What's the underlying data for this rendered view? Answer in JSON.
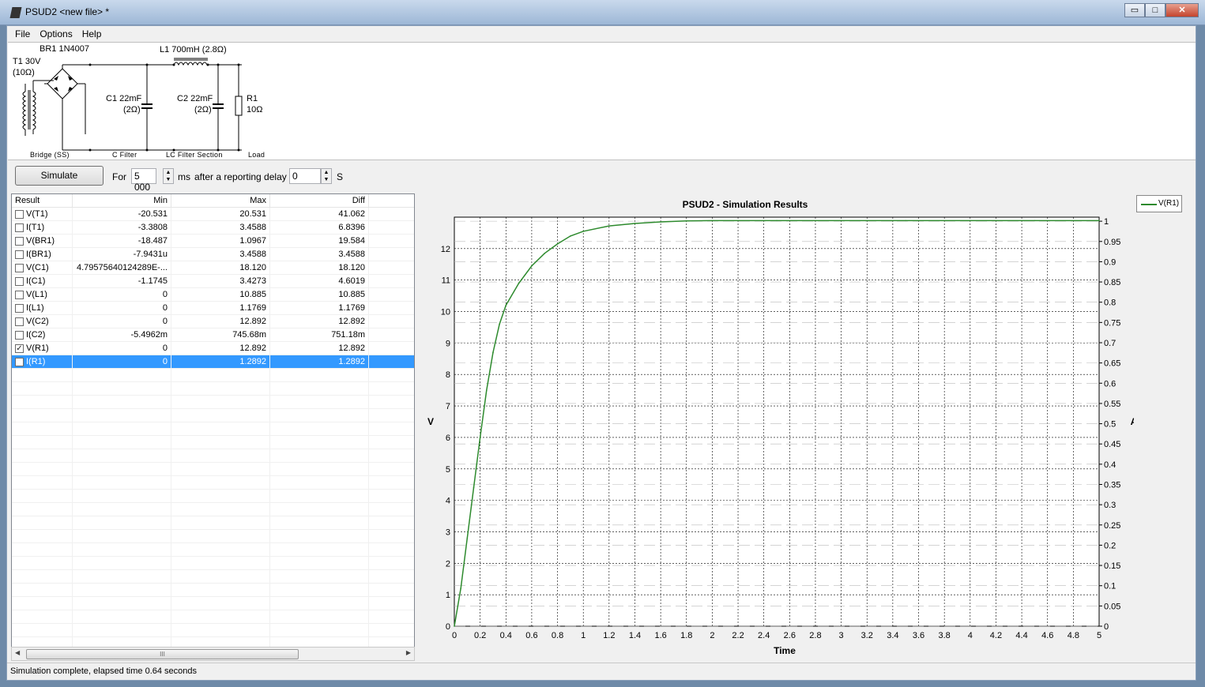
{
  "window": {
    "title": "PSUD2  <new file> *",
    "minimize_glyph": "▭",
    "maximize_glyph": "□",
    "close_glyph": "✕"
  },
  "menu": {
    "file": "File",
    "options": "Options",
    "help": "Help"
  },
  "schematic": {
    "t1_name": "T1 30V",
    "t1_res": "(10Ω)",
    "br1": "BR1 1N4007",
    "l1": "L1 700mH (2.8Ω)",
    "c1_name": "C1 22mF",
    "c1_res": "(2Ω)",
    "c2_name": "C2 22mF",
    "c2_res": "(2Ω)",
    "r1_name": "R1",
    "r1_val": "10Ω",
    "sec_bridge": "Bridge (SS)",
    "sec_cfilter": "C Filter",
    "sec_lc": "LC Filter Section",
    "sec_load": "Load"
  },
  "simbar": {
    "simulate": "Simulate",
    "for_label": "For",
    "duration": "5 000",
    "ms": "ms",
    "after_label": "after a reporting delay of",
    "delay": "0",
    "s": "S"
  },
  "table": {
    "headers": {
      "result": "Result",
      "min": "Min",
      "max": "Max",
      "diff": "Diff"
    },
    "rows": [
      {
        "name": "V(T1)",
        "min": "-20.531",
        "max": "20.531",
        "diff": "41.062",
        "checked": false,
        "selected": false
      },
      {
        "name": "I(T1)",
        "min": "-3.3808",
        "max": "3.4588",
        "diff": "6.8396",
        "checked": false,
        "selected": false
      },
      {
        "name": "V(BR1)",
        "min": "-18.487",
        "max": "1.0967",
        "diff": "19.584",
        "checked": false,
        "selected": false
      },
      {
        "name": "I(BR1)",
        "min": "-7.9431u",
        "max": "3.4588",
        "diff": "3.4588",
        "checked": false,
        "selected": false
      },
      {
        "name": "V(C1)",
        "min": "4.79575640124289E-...",
        "max": "18.120",
        "diff": "18.120",
        "checked": false,
        "selected": false
      },
      {
        "name": "I(C1)",
        "min": "-1.1745",
        "max": "3.4273",
        "diff": "4.6019",
        "checked": false,
        "selected": false
      },
      {
        "name": "V(L1)",
        "min": "0",
        "max": "10.885",
        "diff": "10.885",
        "checked": false,
        "selected": false
      },
      {
        "name": "I(L1)",
        "min": "0",
        "max": "1.1769",
        "diff": "1.1769",
        "checked": false,
        "selected": false
      },
      {
        "name": "V(C2)",
        "min": "0",
        "max": "12.892",
        "diff": "12.892",
        "checked": false,
        "selected": false
      },
      {
        "name": "I(C2)",
        "min": "-5.4962m",
        "max": "745.68m",
        "diff": "751.18m",
        "checked": false,
        "selected": false
      },
      {
        "name": "V(R1)",
        "min": "0",
        "max": "12.892",
        "diff": "12.892",
        "checked": true,
        "selected": false
      },
      {
        "name": "I(R1)",
        "min": "0",
        "max": "1.2892",
        "diff": "1.2892",
        "checked": false,
        "selected": true
      }
    ],
    "scroll_left": "◀",
    "scroll_right": "▶",
    "thumb_grip": "III",
    "check_glyph": "✓"
  },
  "status": "Simulation complete, elapsed time 0.64 seconds",
  "colors": {
    "series": "#2d8a2d",
    "selection": "#3399ff"
  },
  "chart_data": {
    "type": "line",
    "title": "PSUD2 - Simulation Results",
    "xlabel": "Time",
    "ylabel": "V",
    "y2label": "A",
    "xlim": [
      0,
      5
    ],
    "ylim": [
      0,
      13
    ],
    "y2lim": [
      0,
      1.01
    ],
    "x_ticks": [
      "0",
      "0.2",
      "0.4",
      "0.6",
      "0.8",
      "1",
      "1.2",
      "1.4",
      "1.6",
      "1.8",
      "2",
      "2.2",
      "2.4",
      "2.6",
      "2.8",
      "3",
      "3.2",
      "3.4",
      "3.6",
      "3.8",
      "4",
      "4.2",
      "4.4",
      "4.6",
      "4.8",
      "5"
    ],
    "y_ticks": [
      "0",
      "1",
      "2",
      "3",
      "4",
      "5",
      "6",
      "7",
      "8",
      "9",
      "10",
      "11",
      "12"
    ],
    "y2_ticks": [
      "0",
      "0.05",
      "0.1",
      "0.15",
      "0.2",
      "0.25",
      "0.3",
      "0.35",
      "0.4",
      "0.45",
      "0.5",
      "0.55",
      "0.6",
      "0.65",
      "0.7",
      "0.75",
      "0.8",
      "0.85",
      "0.9",
      "0.95",
      "1"
    ],
    "grid": true,
    "legend_position": "top-right",
    "series": [
      {
        "name": "V(R1)",
        "x": [
          0,
          0.05,
          0.1,
          0.15,
          0.2,
          0.25,
          0.3,
          0.35,
          0.4,
          0.5,
          0.6,
          0.7,
          0.8,
          0.9,
          1.0,
          1.2,
          1.4,
          1.6,
          1.8,
          2.0,
          2.5,
          3.0,
          3.5,
          4.0,
          4.5,
          5.0
        ],
        "y": [
          0,
          1.2,
          2.8,
          4.4,
          6.0,
          7.5,
          8.7,
          9.6,
          10.2,
          10.9,
          11.45,
          11.85,
          12.15,
          12.4,
          12.55,
          12.72,
          12.8,
          12.85,
          12.88,
          12.89,
          12.89,
          12.89,
          12.89,
          12.89,
          12.89,
          12.89
        ]
      }
    ]
  }
}
